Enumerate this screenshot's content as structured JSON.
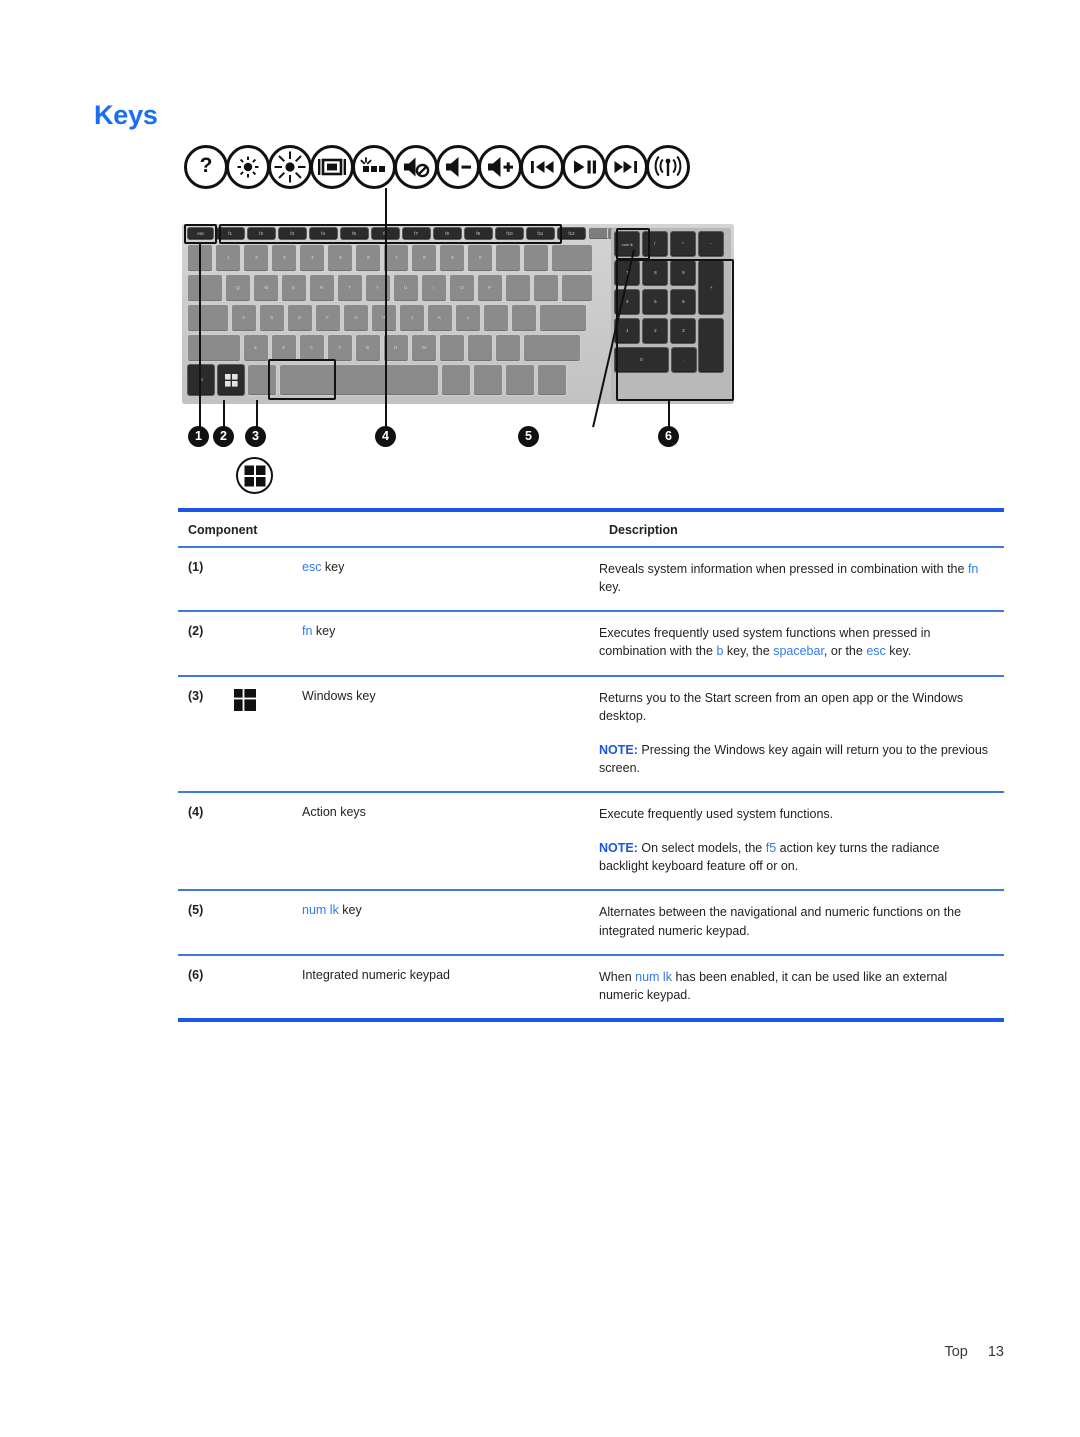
{
  "document": {
    "title": "Keys",
    "title_color": "#1a6ef5",
    "accent_color": "#1a56e8",
    "keyword_color": "#2f7bf0"
  },
  "figure": {
    "name": "keyboard-diagram",
    "action_key_icons": [
      "help-question-icon",
      "brightness-down-icon",
      "brightness-up-icon",
      "switch-screen-image-icon",
      "keyboard-backlight-icon",
      "mute-icon",
      "volume-down-icon",
      "volume-up-icon",
      "previous-track-icon",
      "play-pause-icon",
      "next-track-icon",
      "wireless-icon"
    ],
    "callouts": [
      {
        "number": "1",
        "target": "esc-key"
      },
      {
        "number": "2",
        "target": "fn-key"
      },
      {
        "number": "3",
        "target": "windows-key"
      },
      {
        "number": "4",
        "target": "action-keys"
      },
      {
        "number": "5",
        "target": "num-lk-key"
      },
      {
        "number": "6",
        "target": "integrated-numeric-keypad"
      }
    ],
    "windows_badge": "windows-logo-icon",
    "function_row_labels": [
      "esc",
      "f1",
      "f2",
      "f3",
      "f4",
      "f5",
      "f6",
      "f7",
      "f8",
      "f9",
      "f10",
      "f11",
      "f12"
    ],
    "numpad_top_label": "num lk"
  },
  "table": {
    "headers": {
      "component": "Component",
      "description": "Description"
    },
    "rows": [
      {
        "num": "(1)",
        "icon": "",
        "component_parts": [
          {
            "text": "esc",
            "style": "keyword"
          },
          {
            "text": " key",
            "style": "plain"
          }
        ],
        "description": [
          [
            {
              "text": "Reveals system information when pressed in combination with the ",
              "style": "plain"
            },
            {
              "text": "fn",
              "style": "keyword"
            },
            {
              "text": " key.",
              "style": "plain"
            }
          ]
        ]
      },
      {
        "num": "(2)",
        "icon": "",
        "component_parts": [
          {
            "text": "fn",
            "style": "keyword"
          },
          {
            "text": " key",
            "style": "plain"
          }
        ],
        "description": [
          [
            {
              "text": "Executes frequently used system functions when pressed in combination with the ",
              "style": "plain"
            },
            {
              "text": "b",
              "style": "keyword"
            },
            {
              "text": " key, the ",
              "style": "plain"
            },
            {
              "text": "spacebar",
              "style": "keyword"
            },
            {
              "text": ", or the ",
              "style": "plain"
            },
            {
              "text": "esc",
              "style": "keyword"
            },
            {
              "text": " key.",
              "style": "plain"
            }
          ]
        ]
      },
      {
        "num": "(3)",
        "icon": "windows-logo-icon",
        "component_parts": [
          {
            "text": "Windows key",
            "style": "plain"
          }
        ],
        "description": [
          [
            {
              "text": "Returns you to the Start screen from an open app or the Windows desktop.",
              "style": "plain"
            }
          ],
          [
            {
              "text": "NOTE:",
              "style": "note"
            },
            {
              "text": "  Pressing the Windows key again will return you to the previous screen.",
              "style": "plain"
            }
          ]
        ]
      },
      {
        "num": "(4)",
        "icon": "",
        "component_parts": [
          {
            "text": "Action keys",
            "style": "plain"
          }
        ],
        "description": [
          [
            {
              "text": "Execute frequently used system functions.",
              "style": "plain"
            }
          ],
          [
            {
              "text": "NOTE:",
              "style": "note"
            },
            {
              "text": "  On select models, the ",
              "style": "plain"
            },
            {
              "text": "f5",
              "style": "keyword"
            },
            {
              "text": " action key turns the radiance backlight keyboard feature off or on.",
              "style": "plain"
            }
          ]
        ]
      },
      {
        "num": "(5)",
        "icon": "",
        "component_parts": [
          {
            "text": "num lk",
            "style": "keyword"
          },
          {
            "text": " key",
            "style": "plain"
          }
        ],
        "description": [
          [
            {
              "text": "Alternates between the navigational and numeric functions on the integrated numeric keypad.",
              "style": "plain"
            }
          ]
        ]
      },
      {
        "num": "(6)",
        "icon": "",
        "component_parts": [
          {
            "text": "Integrated numeric keypad",
            "style": "plain"
          }
        ],
        "description": [
          [
            {
              "text": "When ",
              "style": "plain"
            },
            {
              "text": "num lk",
              "style": "keyword"
            },
            {
              "text": " has been enabled, it can be used like an external numeric keypad.",
              "style": "plain"
            }
          ]
        ]
      }
    ]
  },
  "footer": {
    "label": "Top",
    "page": "13"
  }
}
